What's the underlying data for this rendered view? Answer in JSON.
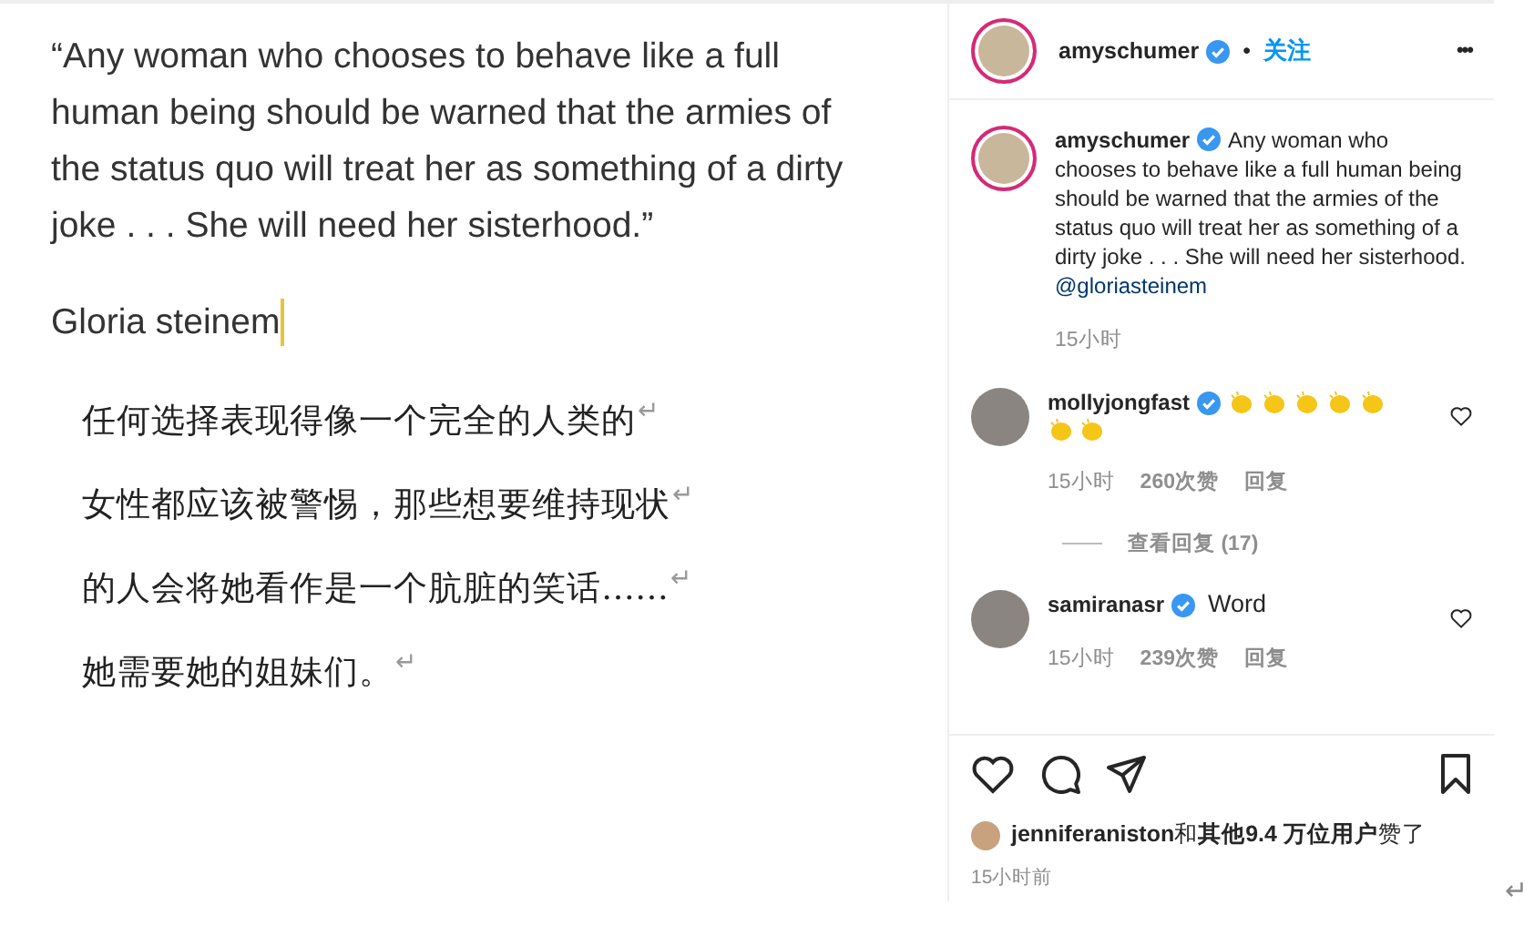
{
  "document": {
    "quote": "“Any woman who chooses to behave like a full human being should be warned that the armies of the status quo will treat her as something of a dirty joke . . . She will need her sisterhood.”",
    "author": "Gloria steinem",
    "translation": [
      {
        "text": "任何选择表现得像一个完全的人类的",
        "mark": "↵"
      },
      {
        "text": "女性都应该被警惕，那些想要维持现状",
        "mark": "↵"
      },
      {
        "text": "的人会将她看作是一个肮脏的笑话……",
        "mark": "↵"
      },
      {
        "text": "她需要她的姐妹们。",
        "mark": "↵"
      }
    ]
  },
  "post": {
    "header": {
      "username": "amyschumer",
      "verified": true,
      "separator": "•",
      "follow": "关注",
      "more": "•••"
    },
    "caption": {
      "username": "amyschumer",
      "verified": true,
      "text": "Any woman who chooses to behave like a full human being should be warned that the armies of the status quo will treat her as something of a dirty joke . . . She will need her sisterhood.",
      "mention": "@gloriasteinem",
      "time": "15小时"
    },
    "comments": [
      {
        "username": "mollyjongfast",
        "verified": true,
        "claps": true,
        "time": "15小时",
        "likes": "260次赞",
        "reply": "回复",
        "view_replies": "查看回复 (17)"
      },
      {
        "username": "samiranasr",
        "verified": true,
        "text": "Word",
        "claps": false,
        "time": "15小时",
        "likes": "239次赞",
        "reply": "回复"
      }
    ],
    "liked_by": {
      "user": "jenniferaniston",
      "joiner": "和",
      "others": "其他9.4 万位用户",
      "suffix": "赞了"
    },
    "time": "15小时前"
  },
  "end_mark": "↵"
}
